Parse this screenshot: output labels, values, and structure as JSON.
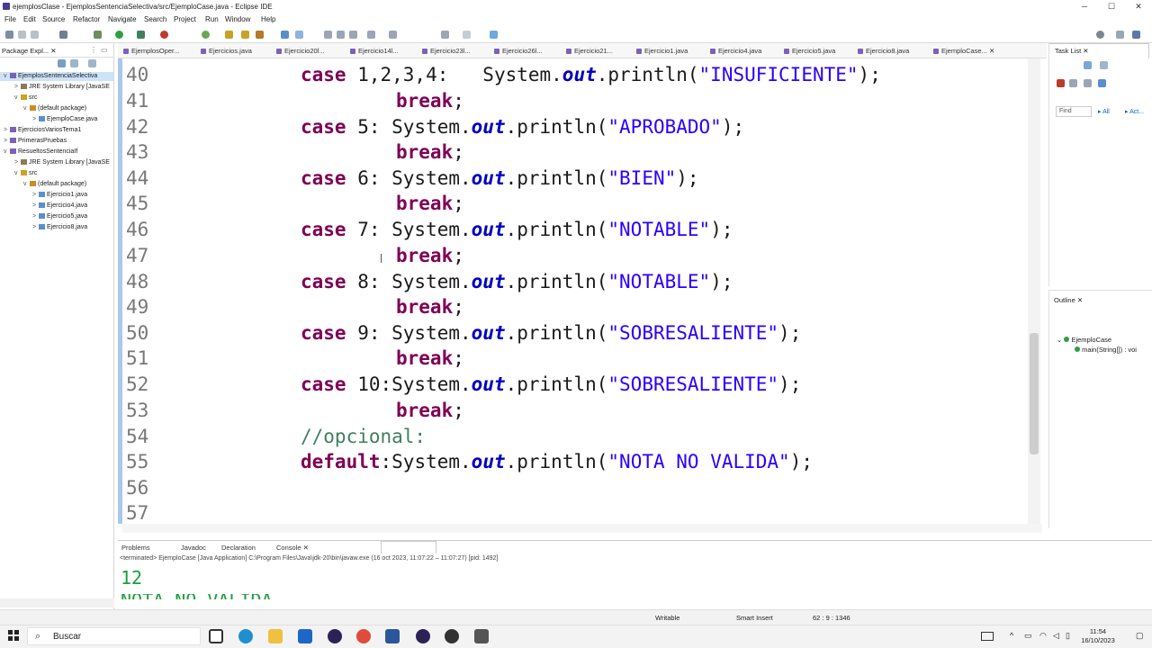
{
  "window": {
    "title": "ejemplosClase - EjemplosSentenciaSelectiva/src/EjemploCase.java - Eclipse IDE",
    "minimize": "─",
    "maximize": "☐",
    "close": "✕"
  },
  "menu": [
    "File",
    "Edit",
    "Source",
    "Refactor",
    "Navigate",
    "Search",
    "Project",
    "Run",
    "Window",
    "Help"
  ],
  "package_explorer": {
    "tab_label": "Package Expl...",
    "tree": [
      {
        "label": "EjemplosSentenciaSelectiva",
        "arrow": "v"
      },
      {
        "label": "JRE System Library [JavaSE",
        "arrow": ">"
      },
      {
        "label": "src",
        "arrow": "v"
      },
      {
        "label": "(default package)",
        "arrow": "v"
      },
      {
        "label": "EjemploCase.java",
        "arrow": ">"
      },
      {
        "label": "EjerciciosVariosTema1",
        "arrow": ">"
      },
      {
        "label": "PrimerasPruebas",
        "arrow": ">"
      },
      {
        "label": "ResueltosSentenciaIf",
        "arrow": "v"
      },
      {
        "label": "JRE System Library [JavaSE",
        "arrow": ">"
      },
      {
        "label": "src",
        "arrow": "v"
      },
      {
        "label": "(default package)",
        "arrow": "v"
      },
      {
        "label": "Ejercicio1.java",
        "arrow": ">"
      },
      {
        "label": "Ejercicio4.java",
        "arrow": ">"
      },
      {
        "label": "Ejercicio5.java",
        "arrow": ">"
      },
      {
        "label": "Ejercicio8.java",
        "arrow": ">"
      }
    ]
  },
  "editor_tabs": [
    "EjemplosOper...",
    "Ejercicios.java",
    "Ejercicio20l...",
    "Ejercicio14l...",
    "Ejercicio23l...",
    "Ejercicio26l...",
    "Ejercicio21...",
    "Ejercicio1.java",
    "Ejercicio4.java",
    "Ejercicio5.java",
    "Ejercicio8.java",
    "EjemploCase..."
  ],
  "code": {
    "line_numbers": [
      "40",
      "41",
      "42",
      "43",
      "44",
      "45",
      "46",
      "47",
      "48",
      "49",
      "50",
      "51",
      "52",
      "53",
      "54",
      "55",
      "56",
      "57"
    ],
    "l40_kw": "case",
    "l40_rest": " 1,2,3,4:   System.",
    "l40_out": "out",
    "l40_call": ".println(",
    "l40_str": "\"INSUFICIENTE\"",
    "l40_end": ");",
    "break_kw": "break",
    "semi": ";",
    "l42_num": " 5: System.",
    "l42_str": "\"APROBADO\"",
    "l44_num": " 6: System.",
    "l44_str": "\"BIEN\"",
    "l46_num": " 7: System.",
    "l46_str": "\"NOTABLE\"",
    "l48_num": " 8: System.",
    "l48_str": "\"NOTABLE\"",
    "l50_num": " 9: System.",
    "l50_str": "\"SOBRESALIENTE\"",
    "l52_num": " 10:System.",
    "l52_str": "\"SOBRESALIENTE\"",
    "l54_comment": "//opcional:",
    "l55_kw": "default",
    "l55_rest": ":System.",
    "l55_str": "\"NOTA NO VALIDA\"",
    "out": "out",
    "println": ".println(",
    "close": ");"
  },
  "task_list": {
    "title": "Task List",
    "find_placeholder": "Find",
    "all": "All",
    "activate": "Act..."
  },
  "outline": {
    "title": "Outline",
    "class": "EjemploCase",
    "method": "main(String[]) : voi"
  },
  "console": {
    "tabs": [
      "Problems",
      "Javadoc",
      "Declaration",
      "Console"
    ],
    "terminated": "<terminated> EjemploCase [Java Application] C:\\Program Files\\Java\\jdk-20\\bin\\javaw.exe  (16 oct 2023, 11:07:22 – 11:07:27) [pid: 1492]",
    "output": "12",
    "output2": "NOTA NO VALIDA"
  },
  "status": {
    "writable": "Writable",
    "insert": "Smart Insert",
    "position": "62 : 9 : 1346"
  },
  "taskbar": {
    "search": "Buscar",
    "time": "11:54",
    "date": "16/10/2023"
  }
}
